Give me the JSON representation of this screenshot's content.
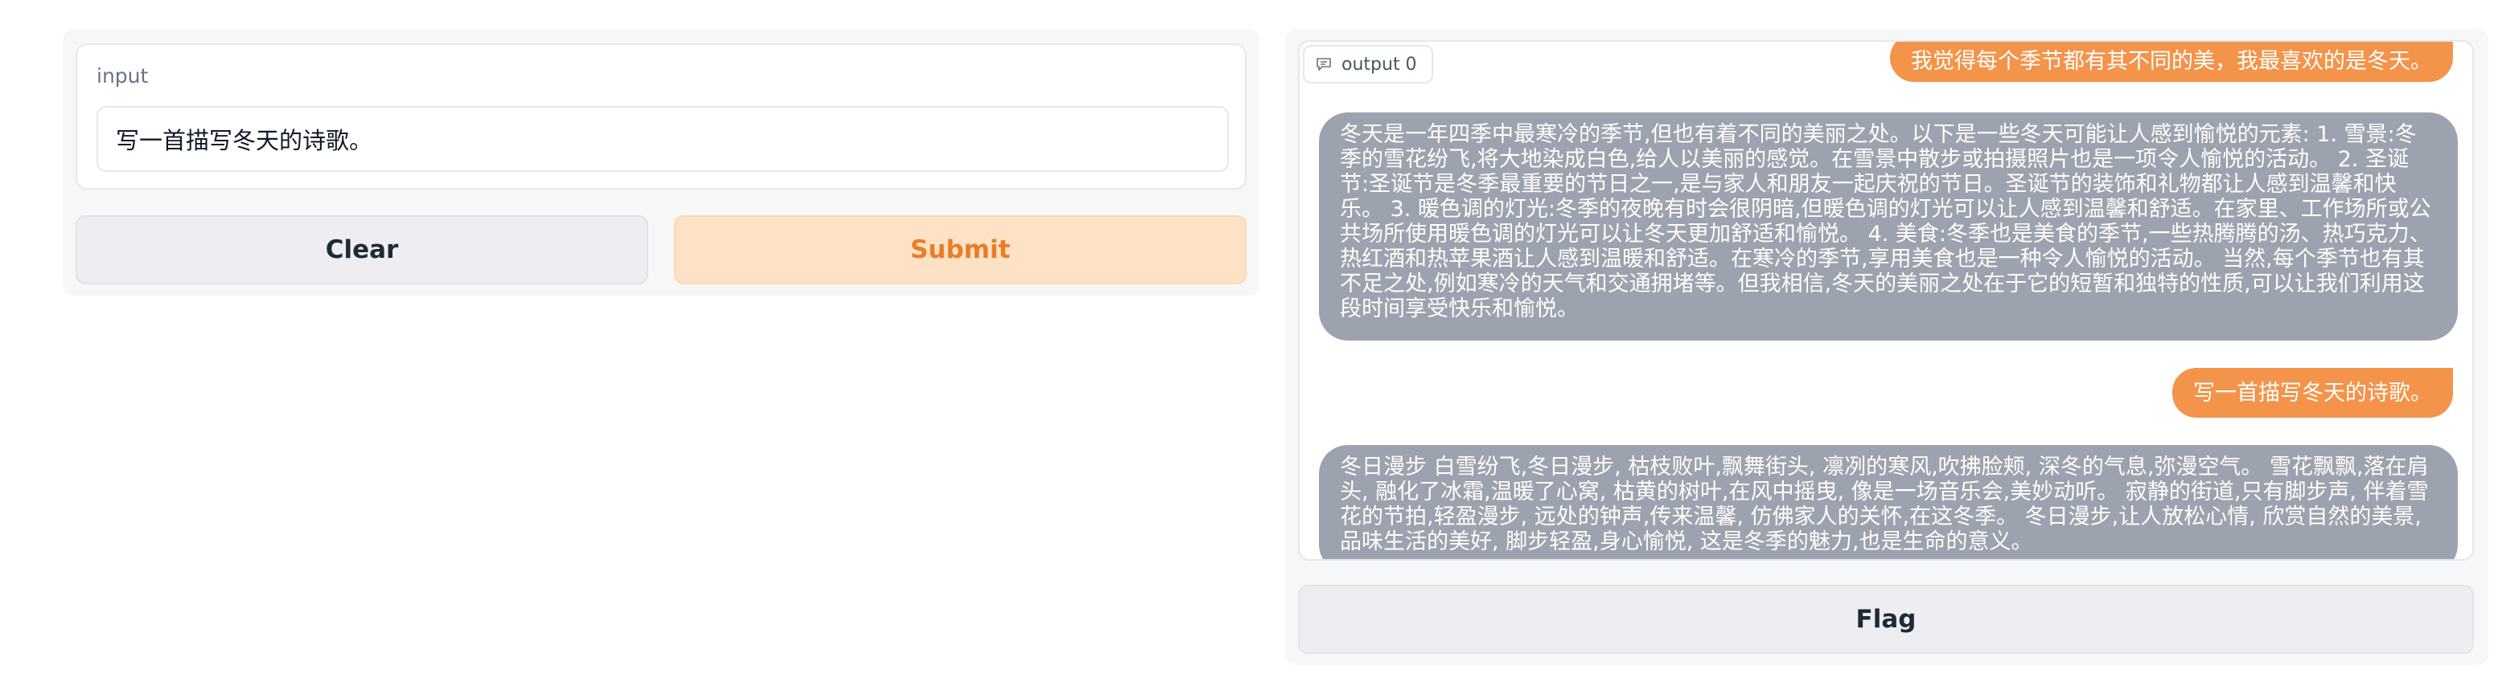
{
  "input": {
    "label": "input",
    "value": "写一首描写冬天的诗歌。"
  },
  "buttons": {
    "clear": "Clear",
    "submit": "Submit",
    "flag": "Flag"
  },
  "output": {
    "label": "output 0",
    "label_icon": "chat-icon",
    "messages": [
      {
        "role": "user",
        "text": "我觉得每个季节都有其不同的美，我最喜欢的是冬天。"
      },
      {
        "role": "bot",
        "text": "冬天是一年四季中最寒冷的季节,但也有着不同的美丽之处。以下是一些冬天可能让人感到愉悦的元素: 1. 雪景:冬季的雪花纷飞,将大地染成白色,给人以美丽的感觉。在雪景中散步或拍摄照片也是一项令人愉悦的活动。 2. 圣诞节:圣诞节是冬季最重要的节日之一,是与家人和朋友一起庆祝的节日。圣诞节的装饰和礼物都让人感到温馨和快乐。 3. 暖色调的灯光:冬季的夜晚有时会很阴暗,但暖色调的灯光可以让人感到温馨和舒适。在家里、工作场所或公共场所使用暖色调的灯光可以让冬天更加舒适和愉悦。 4. 美食:冬季也是美食的季节,一些热腾腾的汤、热巧克力、热红酒和热苹果酒让人感到温暖和舒适。在寒冷的季节,享用美食也是一种令人愉悦的活动。 当然,每个季节也有其不足之处,例如寒冷的天气和交通拥堵等。但我相信,冬天的美丽之处在于它的短暂和独特的性质,可以让我们利用这段时间享受快乐和愉悦。"
      },
      {
        "role": "user",
        "text": "写一首描写冬天的诗歌。"
      },
      {
        "role": "bot",
        "text": "冬日漫步 白雪纷飞,冬日漫步, 枯枝败叶,飘舞街头, 凛冽的寒风,吹拂脸颊, 深冬的气息,弥漫空气。 雪花飘飘,落在肩头, 融化了冰霜,温暖了心窝, 枯黄的树叶,在风中摇曳, 像是一场音乐会,美妙动听。 寂静的街道,只有脚步声, 伴着雪花的节拍,轻盈漫步, 远处的钟声,传来温馨, 仿佛家人的关怀,在这冬季。 冬日漫步,让人放松心情, 欣赏自然的美景,品味生活的美好, 脚步轻盈,身心愉悦, 这是冬季的魅力,也是生命的意义。"
      }
    ]
  },
  "colors": {
    "accent": "#f3944a",
    "submit_bg": "#fde2c6",
    "submit_text": "#ea7d26",
    "bot_bubble": "#9ca3af"
  }
}
